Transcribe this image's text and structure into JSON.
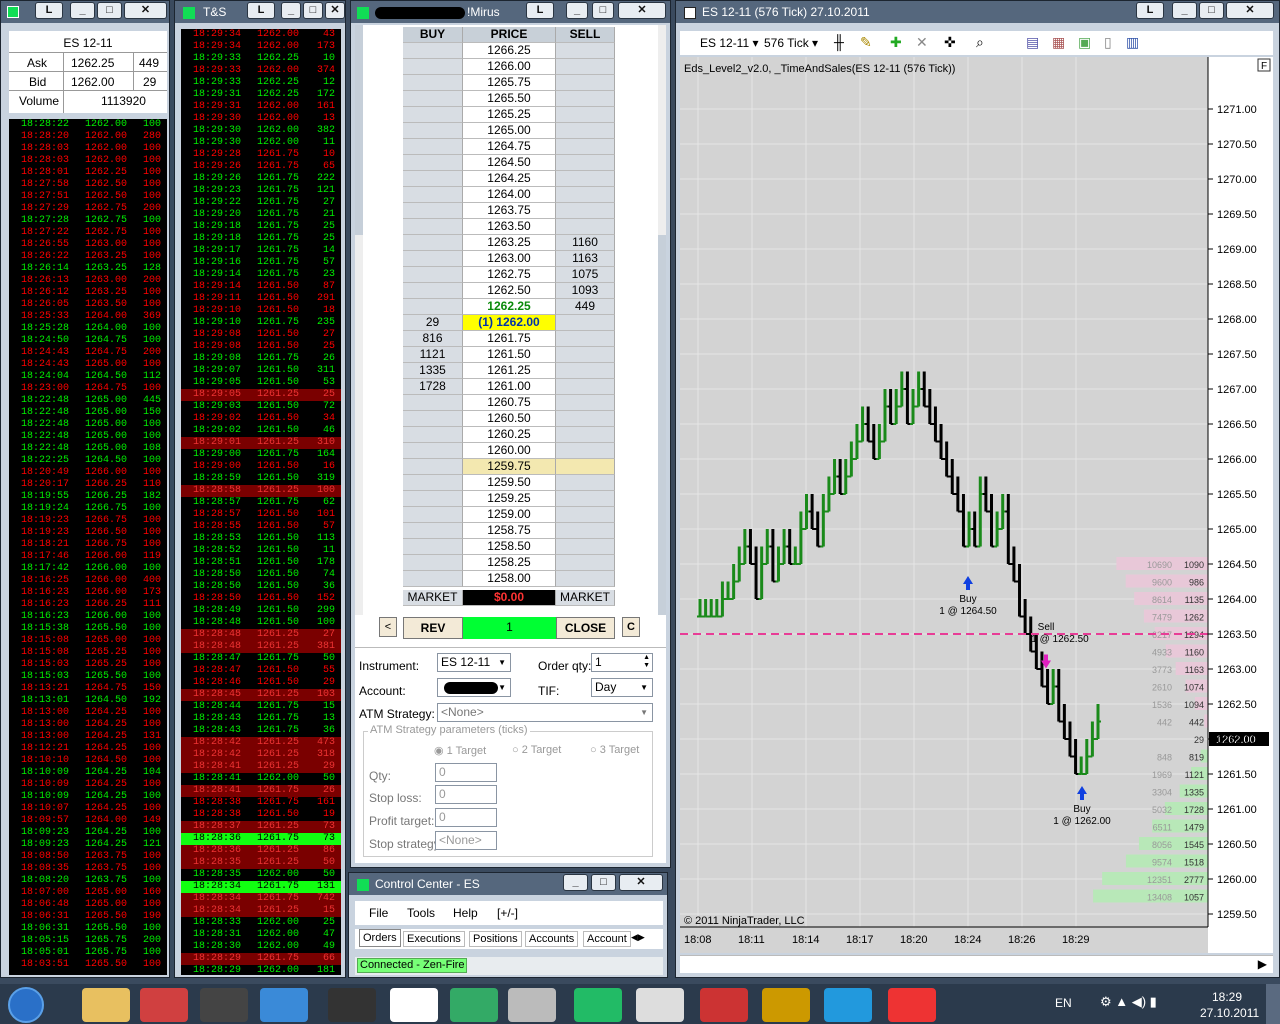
{
  "desktop_icons": {
    "left": "L"
  },
  "win1": {
    "ask_label": "Ask",
    "bid_label": "Bid",
    "volume_label": "Volume",
    "instrument": "ES 12-11",
    "ask": "1262.25",
    "ask_size": "449",
    "bid": "1262.00",
    "bid_size": "29",
    "volume": "1113920",
    "rows": [
      [
        "18:28:22",
        "1262.00",
        "100",
        "g"
      ],
      [
        "18:28:20",
        "1262.00",
        "280",
        "r"
      ],
      [
        "18:28:03",
        "1262.00",
        "100",
        "r"
      ],
      [
        "18:28:03",
        "1262.00",
        "100",
        "r"
      ],
      [
        "18:28:01",
        "1262.25",
        "100",
        "r"
      ],
      [
        "18:27:58",
        "1262.50",
        "100",
        "r"
      ],
      [
        "18:27:51",
        "1262.50",
        "100",
        "r"
      ],
      [
        "18:27:29",
        "1262.75",
        "200",
        "r"
      ],
      [
        "18:27:28",
        "1262.75",
        "100",
        "g"
      ],
      [
        "18:27:22",
        "1262.75",
        "100",
        "r"
      ],
      [
        "18:26:55",
        "1263.00",
        "100",
        "r"
      ],
      [
        "18:26:22",
        "1263.25",
        "100",
        "r"
      ],
      [
        "18:26:14",
        "1263.25",
        "128",
        "g"
      ],
      [
        "18:26:13",
        "1263.00",
        "200",
        "r"
      ],
      [
        "18:26:12",
        "1263.25",
        "100",
        "r"
      ],
      [
        "18:26:05",
        "1263.50",
        "100",
        "r"
      ],
      [
        "18:25:33",
        "1264.00",
        "369",
        "r"
      ],
      [
        "18:25:28",
        "1264.00",
        "100",
        "g"
      ],
      [
        "18:24:50",
        "1264.75",
        "100",
        "g"
      ],
      [
        "18:24:43",
        "1264.75",
        "200",
        "r"
      ],
      [
        "18:24:43",
        "1265.00",
        "100",
        "r"
      ],
      [
        "18:24:04",
        "1264.50",
        "112",
        "g"
      ],
      [
        "18:23:00",
        "1264.75",
        "100",
        "r"
      ],
      [
        "18:22:48",
        "1265.00",
        "445",
        "g"
      ],
      [
        "18:22:48",
        "1265.00",
        "150",
        "g"
      ],
      [
        "18:22:48",
        "1265.00",
        "100",
        "g"
      ],
      [
        "18:22:48",
        "1265.00",
        "100",
        "g"
      ],
      [
        "18:22:48",
        "1265.00",
        "108",
        "g"
      ],
      [
        "18:22:25",
        "1264.50",
        "100",
        "g"
      ],
      [
        "18:20:49",
        "1266.00",
        "100",
        "r"
      ],
      [
        "18:20:17",
        "1266.25",
        "110",
        "r"
      ],
      [
        "18:19:55",
        "1266.25",
        "182",
        "g"
      ],
      [
        "18:19:24",
        "1266.75",
        "100",
        "g"
      ],
      [
        "18:19:23",
        "1266.75",
        "100",
        "r"
      ],
      [
        "18:19:23",
        "1266.50",
        "100",
        "r"
      ],
      [
        "18:18:21",
        "1266.75",
        "100",
        "r"
      ],
      [
        "18:17:46",
        "1266.00",
        "119",
        "r"
      ],
      [
        "18:17:42",
        "1266.00",
        "100",
        "g"
      ],
      [
        "18:16:25",
        "1266.00",
        "400",
        "r"
      ],
      [
        "18:16:23",
        "1266.00",
        "173",
        "r"
      ],
      [
        "18:16:23",
        "1266.25",
        "111",
        "r"
      ],
      [
        "18:16:23",
        "1266.00",
        "100",
        "g"
      ],
      [
        "18:15:38",
        "1265.50",
        "100",
        "g"
      ],
      [
        "18:15:08",
        "1265.00",
        "100",
        "r"
      ],
      [
        "18:15:08",
        "1265.25",
        "100",
        "r"
      ],
      [
        "18:15:03",
        "1265.25",
        "100",
        "r"
      ],
      [
        "18:15:03",
        "1265.50",
        "100",
        "g"
      ],
      [
        "18:13:21",
        "1264.75",
        "150",
        "r"
      ],
      [
        "18:13:01",
        "1264.50",
        "192",
        "g"
      ],
      [
        "18:13:00",
        "1264.25",
        "100",
        "r"
      ],
      [
        "18:13:00",
        "1264.25",
        "100",
        "r"
      ],
      [
        "18:13:00",
        "1264.25",
        "131",
        "r"
      ],
      [
        "18:12:21",
        "1264.25",
        "100",
        "r"
      ],
      [
        "18:10:10",
        "1264.50",
        "100",
        "r"
      ],
      [
        "18:10:09",
        "1264.25",
        "104",
        "g"
      ],
      [
        "18:10:09",
        "1264.25",
        "100",
        "r"
      ],
      [
        "18:10:09",
        "1264.25",
        "100",
        "g"
      ],
      [
        "18:10:07",
        "1264.25",
        "100",
        "r"
      ],
      [
        "18:09:57",
        "1264.00",
        "149",
        "r"
      ],
      [
        "18:09:23",
        "1264.25",
        "100",
        "g"
      ],
      [
        "18:09:23",
        "1264.25",
        "121",
        "g"
      ],
      [
        "18:08:50",
        "1263.75",
        "100",
        "r"
      ],
      [
        "18:08:35",
        "1263.75",
        "100",
        "r"
      ],
      [
        "18:08:20",
        "1263.75",
        "100",
        "g"
      ],
      [
        "18:07:00",
        "1265.00",
        "160",
        "r"
      ],
      [
        "18:06:48",
        "1265.00",
        "100",
        "r"
      ],
      [
        "18:06:31",
        "1265.50",
        "190",
        "r"
      ],
      [
        "18:06:31",
        "1265.50",
        "100",
        "g"
      ],
      [
        "18:05:15",
        "1265.75",
        "200",
        "g"
      ],
      [
        "18:05:01",
        "1265.75",
        "100",
        "g"
      ],
      [
        "18:03:51",
        "1265.50",
        "100",
        "r"
      ]
    ]
  },
  "win2": {
    "title": "T&S",
    "rows": [
      [
        "18:29:34",
        "1262.00",
        "43",
        "r"
      ],
      [
        "18:29:34",
        "1262.00",
        "173",
        "r"
      ],
      [
        "18:29:33",
        "1262.25",
        "10",
        "g"
      ],
      [
        "18:29:33",
        "1262.00",
        "374",
        "r"
      ],
      [
        "18:29:33",
        "1262.25",
        "12",
        "g"
      ],
      [
        "18:29:31",
        "1262.25",
        "172",
        "g"
      ],
      [
        "18:29:31",
        "1262.00",
        "161",
        "r"
      ],
      [
        "18:29:30",
        "1262.00",
        "13",
        "r"
      ],
      [
        "18:29:30",
        "1262.00",
        "382",
        "g"
      ],
      [
        "18:29:30",
        "1262.00",
        "11",
        "g"
      ],
      [
        "18:29:28",
        "1261.75",
        "10",
        "r"
      ],
      [
        "18:29:26",
        "1261.75",
        "65",
        "r"
      ],
      [
        "18:29:26",
        "1261.75",
        "222",
        "g"
      ],
      [
        "18:29:23",
        "1261.75",
        "121",
        "g"
      ],
      [
        "18:29:22",
        "1261.75",
        "27",
        "g"
      ],
      [
        "18:29:20",
        "1261.75",
        "21",
        "g"
      ],
      [
        "18:29:18",
        "1261.75",
        "25",
        "g"
      ],
      [
        "18:29:18",
        "1261.75",
        "25",
        "g"
      ],
      [
        "18:29:17",
        "1261.75",
        "14",
        "g"
      ],
      [
        "18:29:16",
        "1261.75",
        "57",
        "g"
      ],
      [
        "18:29:14",
        "1261.75",
        "23",
        "g"
      ],
      [
        "18:29:14",
        "1261.50",
        "87",
        "r"
      ],
      [
        "18:29:11",
        "1261.50",
        "291",
        "r"
      ],
      [
        "18:29:10",
        "1261.50",
        "18",
        "r"
      ],
      [
        "18:29:10",
        "1261.75",
        "235",
        "g"
      ],
      [
        "18:29:08",
        "1261.50",
        "27",
        "r"
      ],
      [
        "18:29:08",
        "1261.50",
        "25",
        "r"
      ],
      [
        "18:29:08",
        "1261.75",
        "26",
        "g"
      ],
      [
        "18:29:07",
        "1261.50",
        "311",
        "g"
      ],
      [
        "18:29:05",
        "1261.50",
        "53",
        "g"
      ],
      [
        "18:29:05",
        "1261.25",
        "25",
        "B"
      ],
      [
        "18:29:03",
        "1261.50",
        "72",
        "g"
      ],
      [
        "18:29:02",
        "1261.50",
        "34",
        "r"
      ],
      [
        "18:29:02",
        "1261.50",
        "46",
        "g"
      ],
      [
        "18:29:01",
        "1261.25",
        "310",
        "B"
      ],
      [
        "18:29:00",
        "1261.75",
        "164",
        "g"
      ],
      [
        "18:29:00",
        "1261.50",
        "16",
        "r"
      ],
      [
        "18:28:59",
        "1261.50",
        "319",
        "g"
      ],
      [
        "18:28:58",
        "1261.25",
        "100",
        "B"
      ],
      [
        "18:28:57",
        "1261.75",
        "62",
        "g"
      ],
      [
        "18:28:57",
        "1261.50",
        "101",
        "r"
      ],
      [
        "18:28:55",
        "1261.50",
        "57",
        "r"
      ],
      [
        "18:28:53",
        "1261.50",
        "113",
        "g"
      ],
      [
        "18:28:52",
        "1261.50",
        "11",
        "g"
      ],
      [
        "18:28:51",
        "1261.50",
        "178",
        "g"
      ],
      [
        "18:28:50",
        "1261.50",
        "74",
        "g"
      ],
      [
        "18:28:50",
        "1261.50",
        "36",
        "g"
      ],
      [
        "18:28:50",
        "1261.50",
        "152",
        "r"
      ],
      [
        "18:28:49",
        "1261.50",
        "299",
        "g"
      ],
      [
        "18:28:48",
        "1261.50",
        "100",
        "g"
      ],
      [
        "18:28:48",
        "1261.25",
        "27",
        "B"
      ],
      [
        "18:28:48",
        "1261.25",
        "381",
        "B"
      ],
      [
        "18:28:47",
        "1261.75",
        "50",
        "g"
      ],
      [
        "18:28:47",
        "1261.50",
        "55",
        "r"
      ],
      [
        "18:28:46",
        "1261.50",
        "29",
        "r"
      ],
      [
        "18:28:45",
        "1261.25",
        "103",
        "B"
      ],
      [
        "18:28:44",
        "1261.75",
        "15",
        "g"
      ],
      [
        "18:28:43",
        "1261.75",
        "13",
        "g"
      ],
      [
        "18:28:43",
        "1261.75",
        "36",
        "g"
      ],
      [
        "18:28:42",
        "1261.25",
        "473",
        "B"
      ],
      [
        "18:28:42",
        "1261.25",
        "318",
        "B"
      ],
      [
        "18:28:41",
        "1261.25",
        "29",
        "B"
      ],
      [
        "18:28:41",
        "1262.00",
        "50",
        "g"
      ],
      [
        "18:28:41",
        "1261.75",
        "26",
        "B"
      ],
      [
        "18:28:38",
        "1261.75",
        "161",
        "r"
      ],
      [
        "18:28:38",
        "1261.50",
        "19",
        "r"
      ],
      [
        "18:28:37",
        "1261.25",
        "73",
        "B"
      ],
      [
        "18:28:36",
        "1261.75",
        "73",
        "L"
      ],
      [
        "18:28:36",
        "1261.25",
        "86",
        "B"
      ],
      [
        "18:28:35",
        "1261.25",
        "50",
        "B"
      ],
      [
        "18:28:35",
        "1262.00",
        "50",
        "g"
      ],
      [
        "18:28:34",
        "1261.75",
        "131",
        "L"
      ],
      [
        "18:28:34",
        "1261.75",
        "742",
        "B"
      ],
      [
        "18:28:34",
        "1261.25",
        "15",
        "B"
      ],
      [
        "18:28:33",
        "1262.00",
        "25",
        "g"
      ],
      [
        "18:28:31",
        "1262.00",
        "47",
        "g"
      ],
      [
        "18:28:30",
        "1262.00",
        "49",
        "g"
      ],
      [
        "18:28:29",
        "1261.75",
        "66",
        "B"
      ],
      [
        "18:28:29",
        "1262.00",
        "181",
        "g"
      ]
    ]
  },
  "win3": {
    "title": "!Mirus",
    "buy": "BUY",
    "price": "PRICE",
    "sell": "SELL",
    "prices": [
      "1266.25",
      "1266.00",
      "1265.75",
      "1265.50",
      "1265.25",
      "1265.00",
      "1264.75",
      "1264.50",
      "1264.25",
      "1264.00",
      "1263.75",
      "1263.50",
      "1263.25",
      "1263.00",
      "1262.75",
      "1262.50",
      "1262.25",
      "(1) 1262.00",
      "1261.75",
      "1261.50",
      "1261.25",
      "1261.00",
      "1260.75",
      "1260.50",
      "1260.25",
      "1260.00",
      "1259.75",
      "1259.50",
      "1259.25",
      "1259.00",
      "1258.75",
      "1258.50",
      "1258.25",
      "1258.00"
    ],
    "buys": [
      "",
      "",
      "",
      "",
      "",
      "",
      "",
      "",
      "",
      "",
      "",
      "",
      "",
      "",
      "",
      "",
      "",
      "29",
      "816",
      "1121",
      "1335",
      "1728",
      "",
      "",
      "",
      "",
      "",
      "",
      "",
      "",
      "",
      "",
      "",
      ""
    ],
    "sells": [
      "",
      "",
      "",
      "",
      "",
      "",
      "",
      "",
      "",
      "",
      "",
      "",
      "1160",
      "1163",
      "1075",
      "1093",
      "449",
      "",
      "",
      "",
      "",
      "",
      "",
      "",
      "",
      "",
      "",
      "",
      "",
      "",
      "",
      "",
      "",
      ""
    ],
    "market_l": "MARKET",
    "pnl": "$0.00",
    "market_r": "MARKET",
    "lt": "<",
    "rev": "REV",
    "qty": "1",
    "close": "CLOSE",
    "c": "C",
    "instrument_label": "Instrument:",
    "instrument": "ES 12-11",
    "orderqty_label": "Order qty:",
    "orderqty": "1",
    "account_label": "Account:",
    "tif_label": "TIF:",
    "tif": "Day",
    "atm_label": "ATM Strategy:",
    "atm": "<None>",
    "atm_params": "ATM Strategy parameters (ticks)",
    "t1": "1 Target",
    "t2": "2 Target",
    "t3": "3 Target",
    "qty_label": "Qty:",
    "stop_label": "Stop loss:",
    "profit_label": "Profit target:",
    "stopstrat_label": "Stop strategy:",
    "zero": "0",
    "none": "<None>"
  },
  "win4": {
    "title": "Control Center - ES",
    "menu": [
      "File",
      "Tools",
      "Help",
      "[+/-]"
    ],
    "tabs": [
      "Orders",
      "Executions",
      "Positions",
      "Accounts",
      "Account"
    ],
    "status": "Connected - Zen-Fire"
  },
  "win5": {
    "title": "ES 12-11 (576 Tick)  27.10.2011",
    "instrument": "ES 12-11",
    "period": "576 Tick",
    "indicator": "Eds_Level2_v2.0, _TimeAndSales(ES 12-11 (576 Tick))",
    "copyright": "© 2011 NinjaTrader, LLC",
    "f": "F",
    "yticks": [
      "1271.00",
      "1270.50",
      "1270.00",
      "1269.50",
      "1269.00",
      "1268.50",
      "1268.00",
      "1267.50",
      "1267.00",
      "1266.50",
      "1266.00",
      "1265.50",
      "1265.00",
      "1264.50",
      "1264.00",
      "1263.50",
      "1263.00",
      "1262.50",
      "1262.00",
      "1261.50",
      "1261.00",
      "1260.50",
      "1260.00",
      "1259.50"
    ],
    "xticks": [
      "18:08",
      "18:11",
      "18:14",
      "18:17",
      "18:20",
      "18:24",
      "18:26",
      "18:29"
    ],
    "last": "1262.00",
    "sig_buy1": "Buy",
    "sig_buy1_qty": "1 @ 1264.50",
    "sig_sell": "Sell",
    "sig_sell_qty": "1 @ 1262.50",
    "sig_buy2": "Buy",
    "sig_buy2_qty": "1 @ 1262.00",
    "depth": [
      [
        "10690",
        "1090"
      ],
      [
        "9600",
        "986"
      ],
      [
        "8614",
        "1135"
      ],
      [
        "7479",
        "1262"
      ],
      [
        "6217",
        "1294"
      ],
      [
        "4933",
        "1160"
      ],
      [
        "3773",
        "1163"
      ],
      [
        "2610",
        "1074"
      ],
      [
        "1536",
        "1094"
      ],
      [
        "442",
        "442"
      ],
      [
        "",
        "29"
      ],
      [
        "848",
        "819"
      ],
      [
        "1969",
        "1121"
      ],
      [
        "3304",
        "1335"
      ],
      [
        "5032",
        "1728"
      ],
      [
        "6511",
        "1479"
      ],
      [
        "8056",
        "1545"
      ],
      [
        "9574",
        "1518"
      ],
      [
        "12351",
        "2777"
      ],
      [
        "13408",
        "1057"
      ]
    ]
  },
  "taskbar": {
    "lang": "EN",
    "time": "18:29",
    "date": "27.10.2011"
  }
}
